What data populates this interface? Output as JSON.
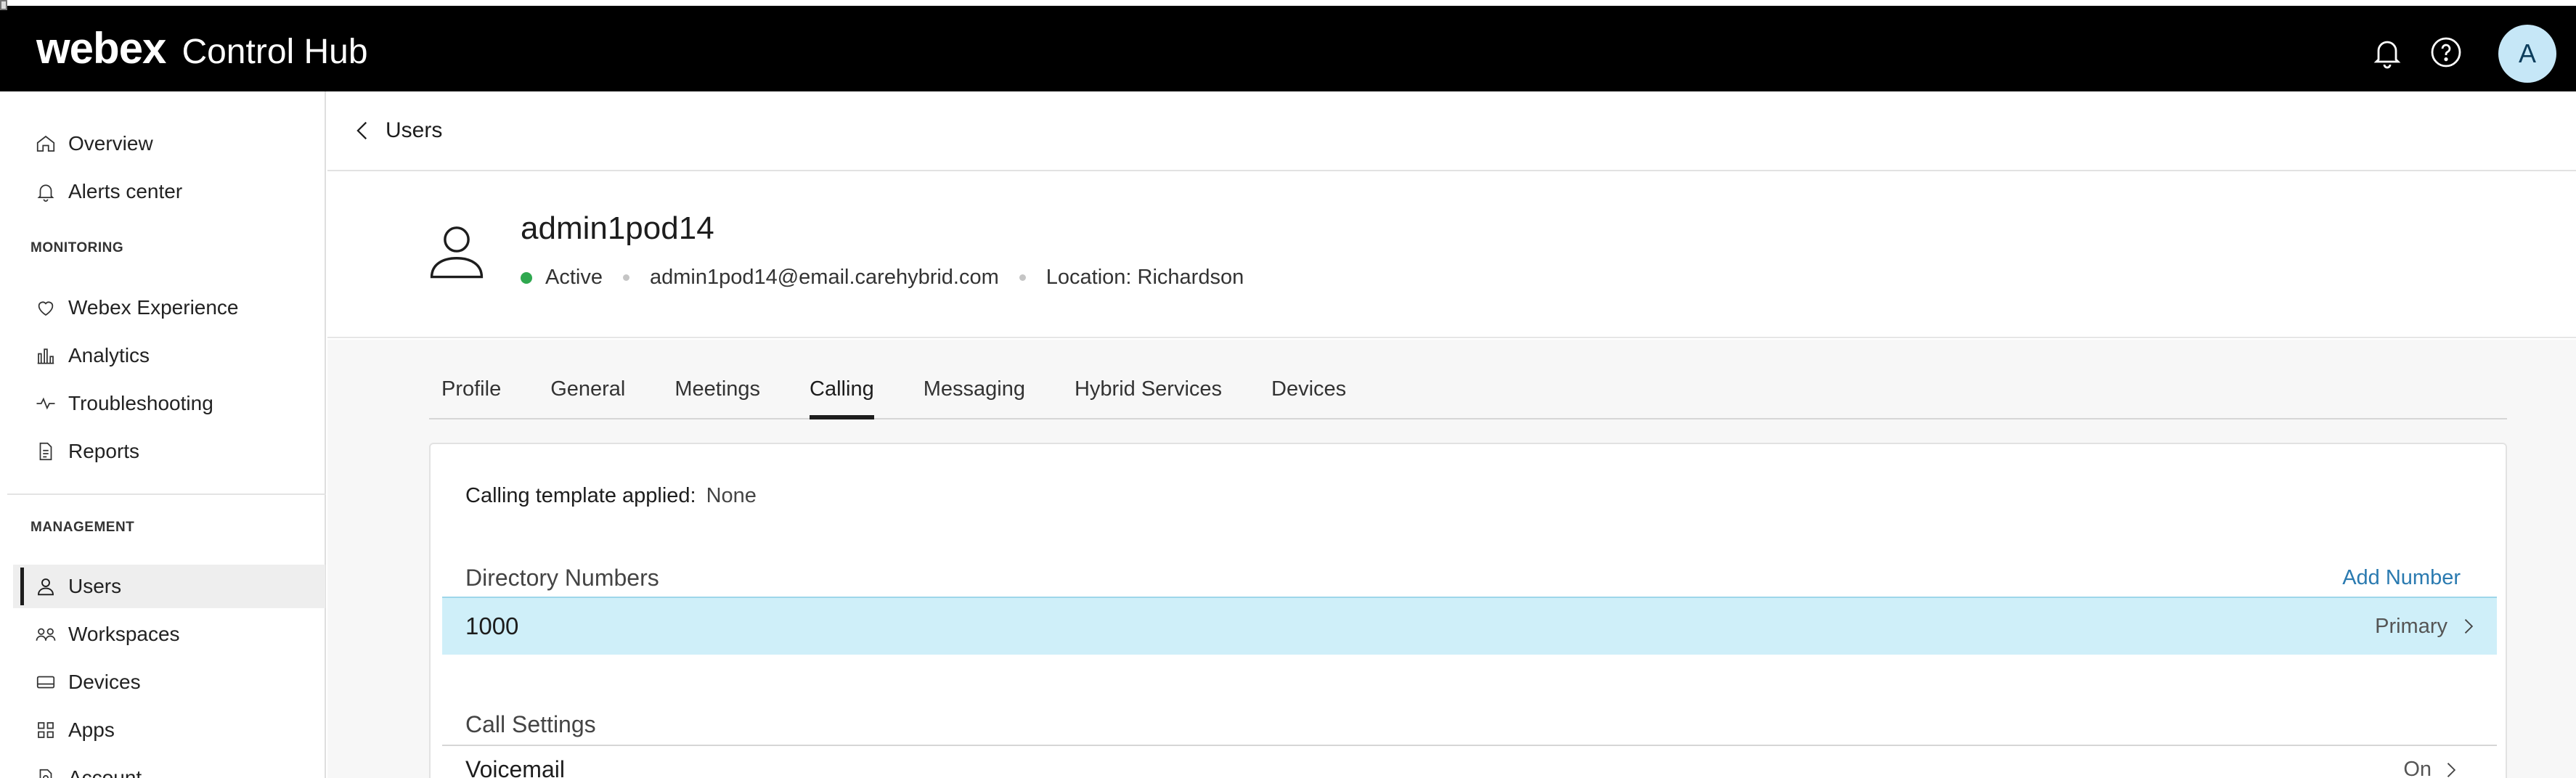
{
  "topbar": {
    "brand_logo": "webex",
    "brand_product": "Control Hub",
    "avatar_initial": "A",
    "icons": [
      "bell-icon",
      "help-icon"
    ]
  },
  "sidebar": {
    "items_top": [
      {
        "label": "Overview",
        "icon": "home-icon"
      },
      {
        "label": "Alerts center",
        "icon": "bell-icon"
      }
    ],
    "monitoring_heading": "MONITORING",
    "monitoring_items": [
      {
        "label": "Webex Experience",
        "icon": "heart-icon"
      },
      {
        "label": "Analytics",
        "icon": "bar-chart-icon"
      },
      {
        "label": "Troubleshooting",
        "icon": "pulse-icon"
      },
      {
        "label": "Reports",
        "icon": "document-icon"
      }
    ],
    "management_heading": "MANAGEMENT",
    "management_items": [
      {
        "label": "Users",
        "icon": "user-icon",
        "active": true
      },
      {
        "label": "Workspaces",
        "icon": "workspaces-icon"
      },
      {
        "label": "Devices",
        "icon": "device-icon"
      },
      {
        "label": "Apps",
        "icon": "apps-icon"
      },
      {
        "label": "Account",
        "icon": "account-icon"
      }
    ]
  },
  "breadcrumb": {
    "label": "Users"
  },
  "user": {
    "name": "admin1pod14",
    "status": "Active",
    "status_color": "#2fa84f",
    "email": "admin1pod14@email.carehybrid.com",
    "location": "Location: Richardson"
  },
  "tabs": [
    {
      "label": "Profile"
    },
    {
      "label": "General"
    },
    {
      "label": "Meetings"
    },
    {
      "label": "Calling",
      "active": true
    },
    {
      "label": "Messaging"
    },
    {
      "label": "Hybrid Services"
    },
    {
      "label": "Devices"
    }
  ],
  "calling": {
    "template_label": "Calling template applied:",
    "template_value": "None",
    "directory_title": "Directory Numbers",
    "add_number_label": "Add Number",
    "number": "1000",
    "number_tag": "Primary",
    "call_settings_title": "Call Settings",
    "voicemail_label": "Voicemail",
    "voicemail_status": "On"
  },
  "colors": {
    "accent_link": "#2a7ab0",
    "selected_row": "#cfeff9",
    "topbar": "#000000"
  }
}
